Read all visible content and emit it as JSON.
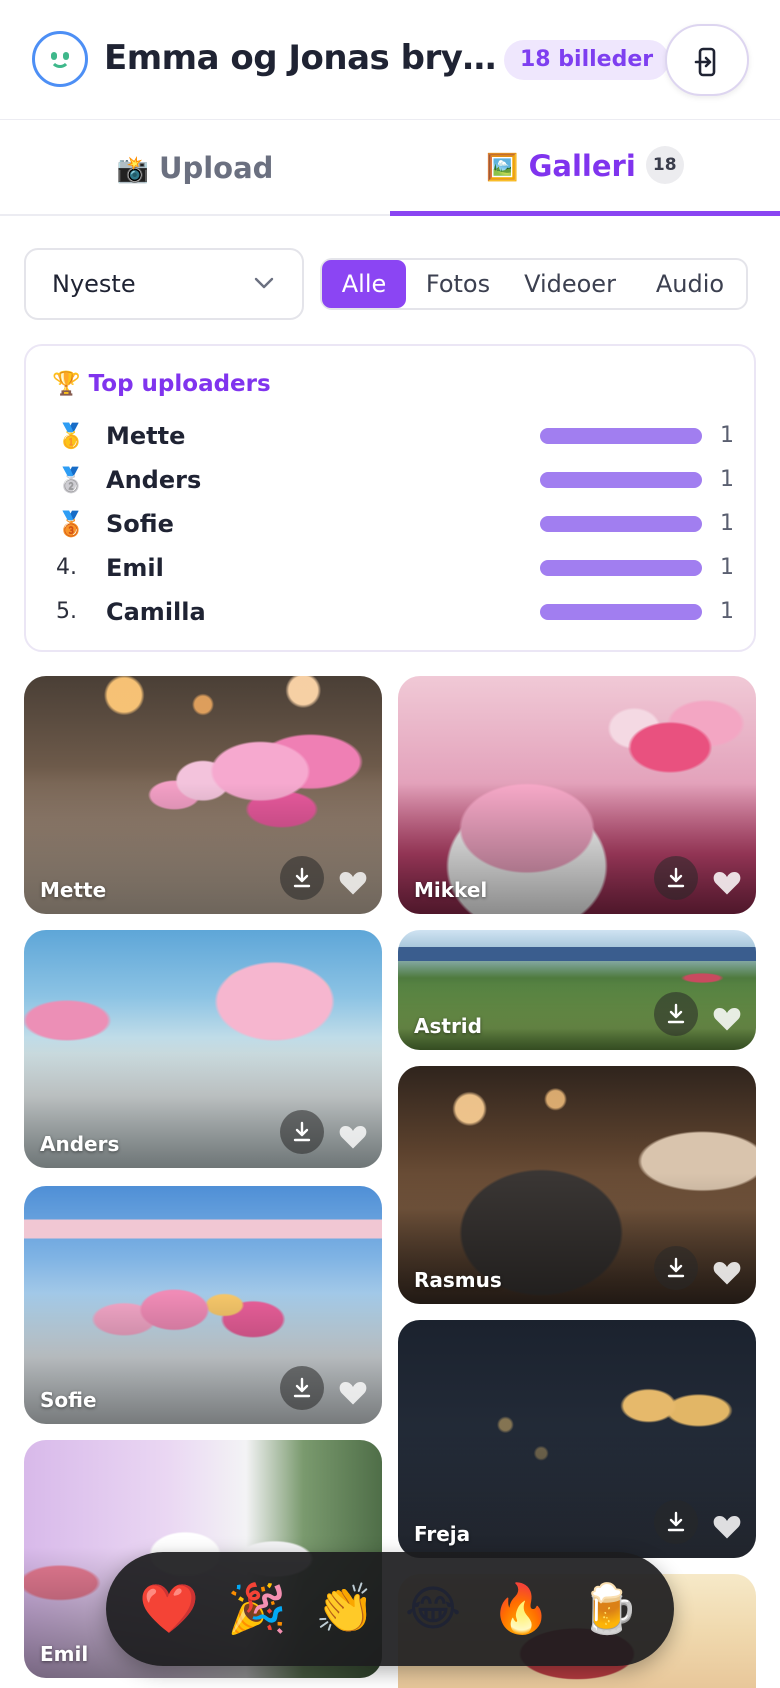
{
  "header": {
    "title": "Emma og Jonas bry…",
    "count_label": "18 billeder"
  },
  "tabs": [
    {
      "emoji": "📸",
      "label": "Upload",
      "active": false
    },
    {
      "emoji": "🖼️",
      "label": "Galleri",
      "active": true,
      "badge": "18"
    }
  ],
  "filters": {
    "sort_value": "Nyeste",
    "types": [
      "Alle",
      "Fotos",
      "Videoer",
      "Audio"
    ],
    "active_type": "Alle"
  },
  "leaderboard": {
    "title": "🏆 Top uploaders",
    "rows": [
      {
        "rank": "🥇",
        "name": "Mette",
        "count": "1"
      },
      {
        "rank": "🥈",
        "name": "Anders",
        "count": "1"
      },
      {
        "rank": "🥉",
        "name": "Sofie",
        "count": "1"
      },
      {
        "rank": "4.",
        "name": "Emil",
        "count": "1"
      },
      {
        "rank": "5.",
        "name": "Camilla",
        "count": "1"
      }
    ]
  },
  "gallery": {
    "left": [
      "Mette",
      "Anders",
      "Sofie",
      "Emil"
    ],
    "right": [
      "Mikkel",
      "Astrid",
      "Rasmus",
      "Freja"
    ]
  },
  "reactions": [
    "❤️",
    "🎉",
    "👏",
    "😂",
    "🔥",
    "🍺"
  ],
  "colors": {
    "accent": "#8b45f3",
    "accent_text": "#8034ee",
    "bar": "#a17ef0",
    "pill_bg": "#efe7fd"
  }
}
